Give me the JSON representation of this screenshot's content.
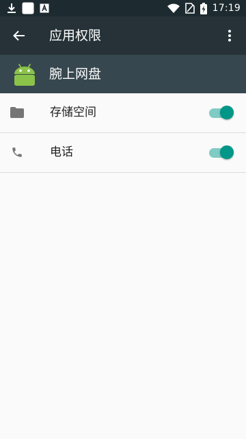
{
  "status_bar": {
    "time": "17:19",
    "icons": [
      "download-icon",
      "square-notification-icon",
      "app-notification-icon",
      "wifi-icon",
      "no-sim-icon",
      "battery-charging-icon"
    ]
  },
  "toolbar": {
    "title": "应用权限",
    "back_icon": "arrow-back-icon",
    "overflow_icon": "more-vertical-icon"
  },
  "app": {
    "name": "腕上网盘",
    "icon": "android-icon",
    "icon_color": "#8bc34a"
  },
  "permissions": [
    {
      "label": "存储空间",
      "icon": "folder-icon",
      "enabled": true
    },
    {
      "label": "电话",
      "icon": "phone-icon",
      "enabled": true
    }
  ],
  "colors": {
    "status_bar": "#1d2a2f",
    "toolbar": "#263238",
    "app_header": "#37474f",
    "accent": "#009688",
    "accent_track": "#80cbc4"
  }
}
